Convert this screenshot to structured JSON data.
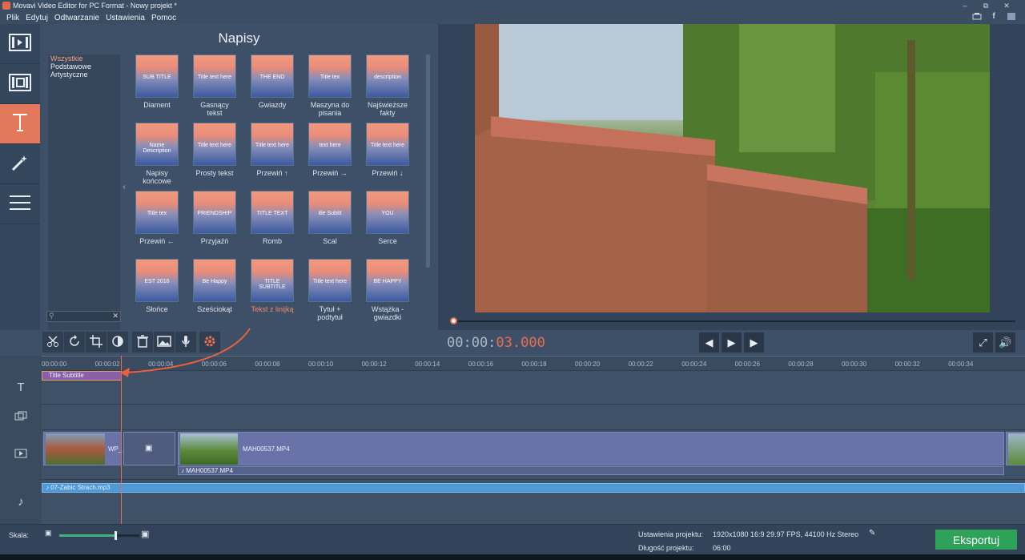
{
  "window": {
    "title": "Movavi Video Editor for PC Format - Nowy projekt *",
    "controls": [
      "–",
      "⧉",
      "✕"
    ]
  },
  "menu": [
    "Plik",
    "Edytuj",
    "Odtwarzanie",
    "Ustawienia",
    "Pomoc"
  ],
  "social_icons": [
    "cart-icon",
    "facebook-icon",
    "vk-icon"
  ],
  "sidenav": [
    {
      "name": "import-icon",
      "active": false
    },
    {
      "name": "filters-icon",
      "active": false
    },
    {
      "name": "titles-icon",
      "active": true
    },
    {
      "name": "effects-icon",
      "active": false
    },
    {
      "name": "more-menu-icon",
      "active": false
    }
  ],
  "panel": {
    "title": "Napisy",
    "categories": [
      "Wszystkie",
      "Podstawowe",
      "Artystyczne"
    ],
    "tiles": [
      {
        "label": "Diament",
        "thumb": "SUB TITLE"
      },
      {
        "label": "Gasnący tekst",
        "thumb": "Title text here"
      },
      {
        "label": "Gwiazdy",
        "thumb": "THE END"
      },
      {
        "label": "Maszyna do pisania",
        "thumb": "Title tex"
      },
      {
        "label": "Najświeższe fakty",
        "thumb": "description"
      },
      {
        "label": "Napisy końcowe",
        "thumb": "Name Description"
      },
      {
        "label": "Prosty tekst",
        "thumb": "Title text here"
      },
      {
        "label": "Przewiń ↑",
        "thumb": "Title text here"
      },
      {
        "label": "Przewiń →",
        "thumb": "text here"
      },
      {
        "label": "Przewiń ↓",
        "thumb": "Title text here"
      },
      {
        "label": "Przewiń ←",
        "thumb": "Title tex"
      },
      {
        "label": "Przyjaźń",
        "thumb": "FRIENDSHIP"
      },
      {
        "label": "Romb",
        "thumb": "TITLE TEXT"
      },
      {
        "label": "Scal",
        "thumb": "itle  Subtit"
      },
      {
        "label": "Serce",
        "thumb": "YOU"
      },
      {
        "label": "Słońce",
        "thumb": "EST 2016"
      },
      {
        "label": "Sześciokąt",
        "thumb": "Be Happy"
      },
      {
        "label": "Tekst z linijką",
        "thumb": "TITLE SUBTITLE"
      },
      {
        "label": "Tytuł + podtytuł",
        "thumb": "Title text here"
      },
      {
        "label": "Wstążka - gwiazdki",
        "thumb": "BE HAPPY"
      }
    ]
  },
  "player": {
    "time_gray": "00:00:",
    "time_red": "03.000"
  },
  "timeline": {
    "ruler": [
      "00:00:00",
      "00:00:02",
      "00:00:04",
      "00:00:06",
      "00:00:08",
      "00:00:10",
      "00:00:12",
      "00:00:14",
      "00:00:16",
      "00:00:18",
      "00:00:20",
      "00:00:22",
      "00:00:24",
      "00:00:26",
      "00:00:28",
      "00:00:30",
      "00:00:32",
      "00:00:34"
    ],
    "title_clip": "Title Subtitle",
    "video_clips": [
      "WP_",
      "MAH00537.MP4"
    ],
    "audio_under_video": "MAH00537.MP4",
    "music_clip": "07-Zabic Strach.mp3"
  },
  "status": {
    "skala_label": "Skala:",
    "zoom_level": 0.7,
    "proj_settings_label": "Ustawienia projektu:",
    "proj_settings_value": "1920x1080 16:9 29.97 FPS, 44100 Hz Stereo",
    "proj_length_label": "Długość projektu:",
    "proj_length_value": "06:00",
    "export_label": "Eksportuj"
  },
  "colors": {
    "accent": "#e86f4e",
    "export": "#2fa25a",
    "title_clip": "#8a5fa8"
  }
}
